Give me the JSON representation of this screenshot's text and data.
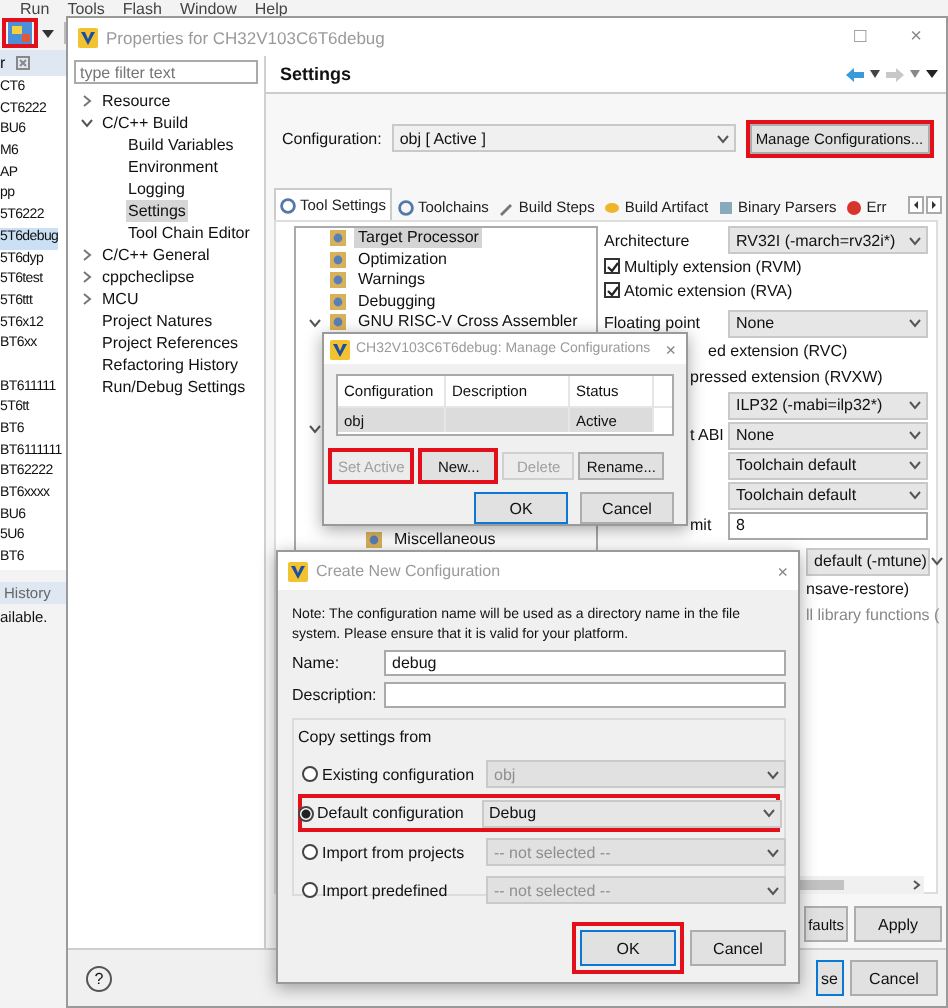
{
  "ide": {
    "menu": [
      "Run",
      "Tools",
      "Flash",
      "Window",
      "Help"
    ],
    "launch_button": {
      "highlighted": true
    },
    "panel_header": "r",
    "projects": [
      {
        "label": "CT6",
        "selected": false
      },
      {
        "label": "CT6222",
        "selected": false
      },
      {
        "label": "BU6",
        "selected": false
      },
      {
        "label": "M6",
        "selected": false
      },
      {
        "label": "AP",
        "selected": false
      },
      {
        "label": "pp",
        "selected": false
      },
      {
        "label": "5T6222",
        "selected": false
      },
      {
        "label": "5T6debug",
        "selected": true
      },
      {
        "label": "5T6dyp",
        "selected": false
      },
      {
        "label": "5T6test",
        "selected": false
      },
      {
        "label": "5T6ttt",
        "selected": false
      },
      {
        "label": "5T6x12",
        "selected": false
      },
      {
        "label": "BT6xx",
        "selected": false
      },
      {
        "label": "BT611111",
        "selected": false
      },
      {
        "label": "5T6tt",
        "selected": false
      },
      {
        "label": "BT6",
        "selected": false
      },
      {
        "label": "BT6111111",
        "selected": false
      },
      {
        "label": "BT62222",
        "selected": false
      },
      {
        "label": "BT6xxxx",
        "selected": false
      },
      {
        "label": "BU6",
        "selected": false
      },
      {
        "label": "5U6",
        "selected": false
      },
      {
        "label": "BT6",
        "selected": false
      }
    ],
    "history_tab": "History",
    "history_text": "ailable."
  },
  "properties": {
    "title": "Properties for CH32V103C6T6debug",
    "window_controls": [
      "□",
      "×"
    ],
    "filter": {
      "placeholder": "type filter text"
    },
    "nav": [
      {
        "label": "Resource",
        "expanded": false,
        "selected": false
      },
      {
        "label": "C/C++ Build",
        "expanded": true,
        "selected": false,
        "children": [
          {
            "label": "Build Variables",
            "selected": false
          },
          {
            "label": "Environment",
            "selected": false
          },
          {
            "label": "Logging",
            "selected": false
          },
          {
            "label": "Settings",
            "selected": true
          },
          {
            "label": "Tool Chain Editor",
            "selected": false
          }
        ]
      },
      {
        "label": "C/C++ General",
        "expanded": false,
        "selected": false
      },
      {
        "label": "cppcheclipse",
        "expanded": false,
        "selected": false
      },
      {
        "label": "MCU",
        "expanded": false,
        "selected": false
      },
      {
        "label": "Project Natures",
        "selected": false
      },
      {
        "label": "Project References",
        "selected": false
      },
      {
        "label": "Refactoring History",
        "selected": false
      },
      {
        "label": "Run/Debug Settings",
        "selected": false
      }
    ],
    "page_title": "Settings",
    "configuration": {
      "label": "Configuration:",
      "value": "obj  [ Active ]"
    },
    "manage_button": {
      "label": "Manage Configurations...",
      "highlighted": true
    },
    "tabs": [
      {
        "label": "Tool Settings",
        "selected": true
      },
      {
        "label": "Toolchains",
        "selected": false
      },
      {
        "label": "Build Steps",
        "selected": false
      },
      {
        "label": "Build Artifact",
        "selected": false
      },
      {
        "label": "Binary Parsers",
        "selected": false
      },
      {
        "label": "Err",
        "selected": false
      }
    ],
    "tool_tree": [
      {
        "label": "Target Processor",
        "selected": true
      },
      {
        "label": "Optimization",
        "selected": false
      },
      {
        "label": "Warnings",
        "selected": false
      },
      {
        "label": "Debugging",
        "selected": false
      },
      {
        "label": "GNU RISC-V Cross Assembler",
        "expanded": true,
        "selected": false
      },
      {
        "expanded": true
      },
      {
        "label": "Miscellaneous",
        "selected": false
      }
    ],
    "options": [
      {
        "kind": "combo",
        "label": "Architecture",
        "value": "RV32I (-march=rv32i*)"
      },
      {
        "kind": "check",
        "label": "Multiply extension (RVM)",
        "checked": true
      },
      {
        "kind": "check",
        "label": "Atomic extension (RVA)",
        "checked": true
      },
      {
        "kind": "combo",
        "label": "Floating point",
        "value": "None"
      },
      {
        "kind": "text",
        "label": "ed extension (RVC)"
      },
      {
        "kind": "text",
        "label": "pressed extension (RVXW)"
      },
      {
        "kind": "combo",
        "value": "ILP32 (-mabi=ilp32*)"
      },
      {
        "kind": "combo",
        "label": "t ABI",
        "value": "None"
      },
      {
        "kind": "combo",
        "value": "Toolchain default"
      },
      {
        "kind": "combo",
        "value": "Toolchain default"
      },
      {
        "kind": "field",
        "label": "mit",
        "value": "8"
      },
      {
        "kind": "combo",
        "value": "default (-mtune)"
      },
      {
        "kind": "text",
        "label": "nsave-restore)"
      },
      {
        "kind": "text",
        "label": "ll library functions ("
      }
    ],
    "buttons": [
      {
        "label": "faults"
      },
      {
        "label": "Apply"
      }
    ],
    "help": "?",
    "footer_buttons": [
      {
        "label": "se",
        "default": true
      },
      {
        "label": "Cancel",
        "default": false
      }
    ]
  },
  "manage_dialog": {
    "title": "CH32V103C6T6debug: Manage Configurations",
    "close": "×",
    "columns": [
      "Configuration",
      "Description",
      "Status"
    ],
    "rows": [
      {
        "configuration": "obj",
        "status": "Active",
        "selected": true
      }
    ],
    "buttons": [
      {
        "label": "Set Active",
        "disabled": true,
        "highlighted": true
      },
      {
        "label": "New...",
        "disabled": false,
        "highlighted": true
      },
      {
        "label": "Delete",
        "disabled": true,
        "highlighted": false
      },
      {
        "label": "Rename...",
        "disabled": false,
        "highlighted": false
      }
    ],
    "actions": [
      {
        "label": "OK",
        "default": true
      },
      {
        "label": "Cancel",
        "default": false
      }
    ]
  },
  "create_dialog": {
    "title": "Create New Configuration",
    "close": "×",
    "note": "Note: The configuration name will be used as a directory name in the file system.  Please ensure that it is valid for your platform.",
    "name": {
      "label": "Name:",
      "value": "debug"
    },
    "description": {
      "label": "Description:"
    },
    "group_title": "Copy settings from",
    "sources": [
      {
        "label": "Existing configuration",
        "selected": false,
        "value": "obj",
        "disabled": true,
        "highlighted": false
      },
      {
        "label": "Default configuration",
        "selected": true,
        "value": "Debug",
        "disabled": false,
        "highlighted": true
      },
      {
        "label": "Import from projects",
        "selected": false,
        "value": "-- not selected --",
        "disabled": true,
        "highlighted": false
      },
      {
        "label": "Import predefined",
        "selected": false,
        "value": "-- not selected --",
        "disabled": true,
        "highlighted": false
      }
    ],
    "buttons": [
      {
        "label": "OK",
        "default": true,
        "highlighted": true
      },
      {
        "label": "Cancel",
        "default": false,
        "highlighted": false
      }
    ]
  }
}
